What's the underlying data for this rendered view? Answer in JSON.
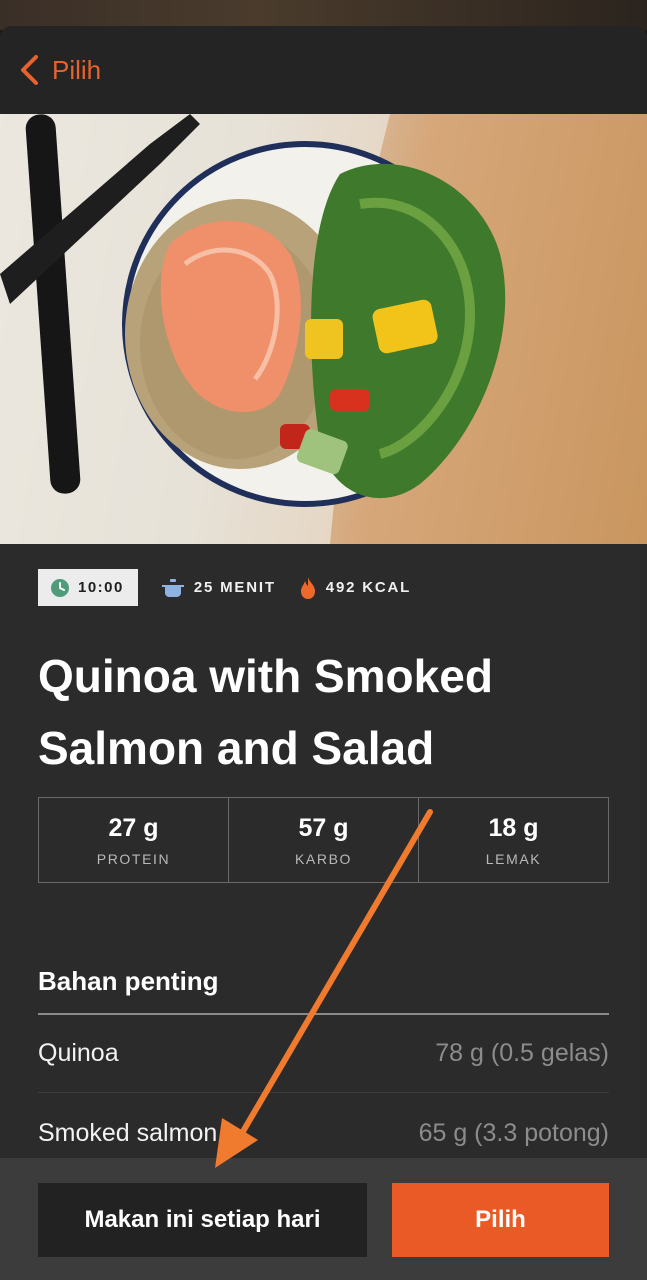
{
  "header": {
    "back_label": "Pilih"
  },
  "meta": {
    "time": "10:00",
    "duration": "25 MENIT",
    "calories": "492 KCAL"
  },
  "title": "Quinoa with Smoked Salmon and Salad",
  "macros": [
    {
      "value": "27 g",
      "label": "PROTEIN"
    },
    {
      "value": "57 g",
      "label": "KARBO"
    },
    {
      "value": "18 g",
      "label": "LEMAK"
    }
  ],
  "ingredients": {
    "heading": "Bahan penting",
    "items": [
      {
        "name": "Quinoa",
        "amount": "78 g (0.5 gelas)"
      },
      {
        "name": "Smoked salmon",
        "amount": "65 g (3.3 potong)"
      }
    ]
  },
  "actions": {
    "daily_label": "Makan ini setiap hari",
    "select_label": "Pilih"
  },
  "colors": {
    "accent": "#ea5a26",
    "background": "#2b2b2b",
    "annotation_arrow": "#f07a2e"
  }
}
